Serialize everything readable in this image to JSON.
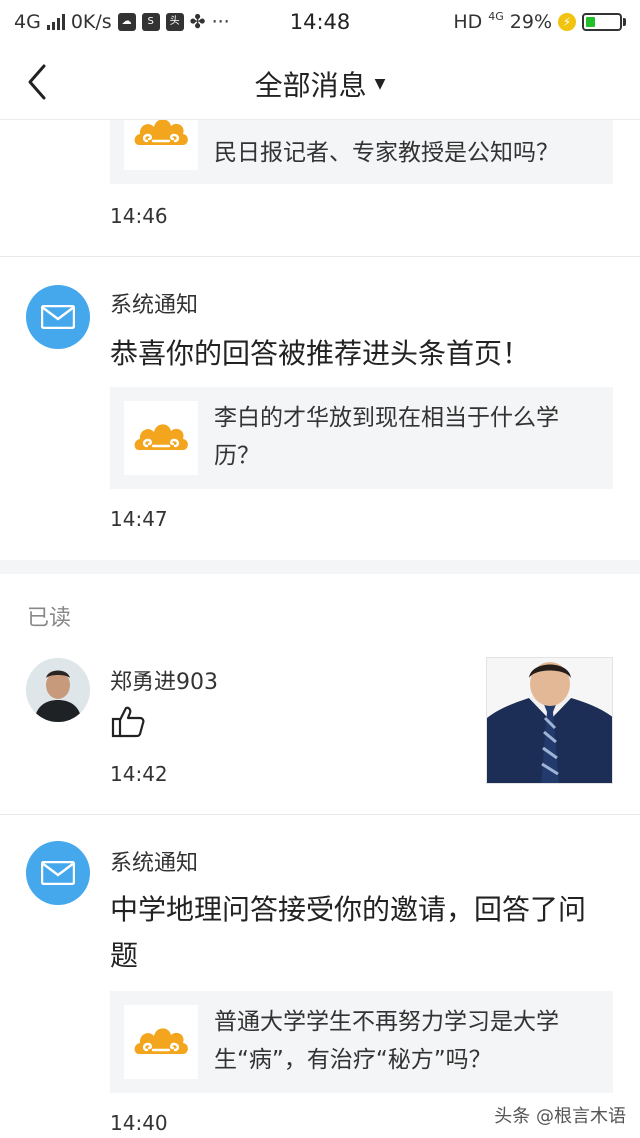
{
  "status_bar": {
    "network": "4G",
    "speed": "0K/s",
    "time": "14:48",
    "hd": "HD",
    "network_right": "4G",
    "battery": "29%",
    "battery_level": 0.29,
    "battery_color": "#22c12a"
  },
  "nav": {
    "title": "全部消息",
    "back_icon": "chevron-left-icon",
    "caret_icon": "caret-down-icon"
  },
  "messages": [
    {
      "quote_text": "民日报记者、专家教授是公知吗？",
      "time": "14:46"
    },
    {
      "sender": "系统通知",
      "text": "恭喜你的回答被推荐进头条首页！",
      "quote_text": "李白的才华放到现在相当于什么学历？",
      "time": "14:47"
    }
  ],
  "read_section": {
    "label": "已读",
    "items": [
      {
        "sender": "郑勇进903",
        "action_icon": "thumbs-up-icon",
        "time": "14:42"
      },
      {
        "sender": "系统通知",
        "text": "中学地理问答接受你的邀请，回答了问题",
        "quote_text": "普通大学学生不再努力学习是大学生“病”，有治疗“秘方”吗？",
        "time": "14:40"
      }
    ]
  },
  "watermark": "头条 @根言木语",
  "colors": {
    "accent_blue": "#46a8ec",
    "logo_orange": "#f2a51d",
    "section_gap": "#f4f5f6"
  }
}
